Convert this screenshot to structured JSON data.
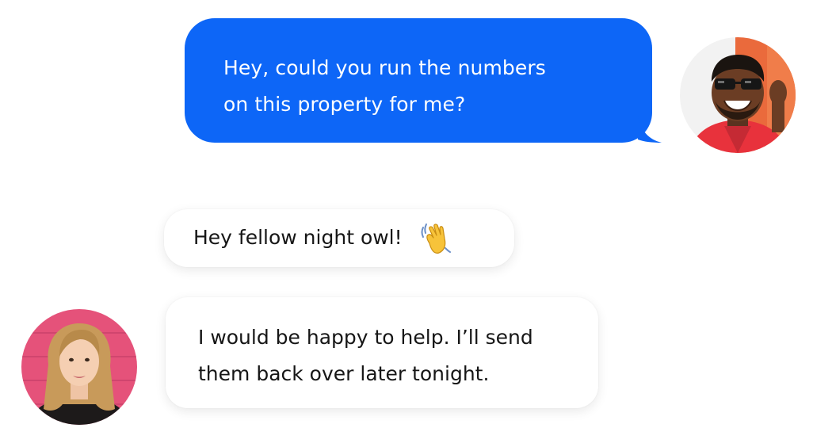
{
  "conversation": {
    "outgoing_message": {
      "lines": [
        "Hey, could you run the numbers",
        "on this property for me?"
      ]
    },
    "incoming_greeting": {
      "text": "Hey fellow night owl!",
      "emoji": "waving-hand-icon"
    },
    "incoming_reply": {
      "lines": [
        "I would be happy to help. I’ll send",
        "them back over later tonight."
      ]
    }
  },
  "colors": {
    "outgoing_bubble": "#0d66f7",
    "incoming_bubble": "#ffffff",
    "incoming_text": "#161616",
    "outgoing_text": "#ffffff"
  }
}
